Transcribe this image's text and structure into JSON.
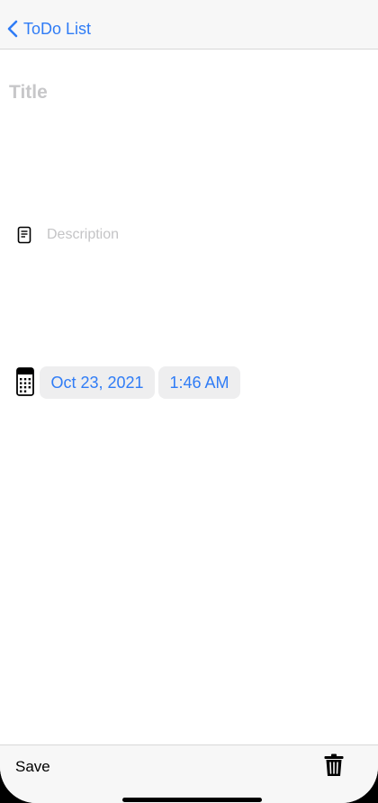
{
  "nav": {
    "back_label": "ToDo List",
    "back_icon": "chevron-left-icon"
  },
  "form": {
    "title_placeholder": "Title",
    "title_value": "",
    "description_placeholder": "Description",
    "description_value": "",
    "description_icon": "note-icon",
    "calendar_icon": "calendar-icon",
    "date": "Oct 23, 2021",
    "time": "1:46 AM"
  },
  "toolbar": {
    "save_label": "Save",
    "delete_icon": "trash-icon"
  },
  "colors": {
    "accent": "#2f7cf6",
    "placeholder": "#c7c7c9",
    "pill_background": "#eeeeef",
    "bar_background": "#f7f7f7"
  }
}
